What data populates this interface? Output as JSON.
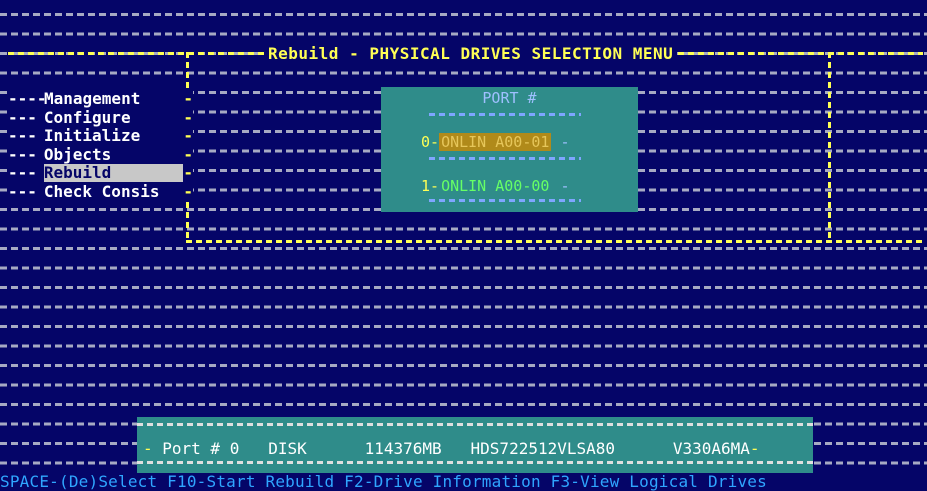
{
  "title": "Rebuild - PHYSICAL DRIVES SELECTION MENU",
  "menu": {
    "items": [
      {
        "label": "Management",
        "lead": "----"
      },
      {
        "label": "Configure",
        "lead": "---"
      },
      {
        "label": "Initialize",
        "lead": "---"
      },
      {
        "label": "Objects",
        "lead": "---"
      },
      {
        "label": "Rebuild",
        "lead": "---"
      },
      {
        "label": "Check Consis",
        "lead": "---"
      }
    ],
    "selected": "Rebuild"
  },
  "port_panel": {
    "header": "PORT #",
    "rows": [
      {
        "index": "0",
        "status": "ONLIN A00-01"
      },
      {
        "index": "1",
        "status": "ONLIN A00-00"
      }
    ]
  },
  "info_bar": {
    "port": "Port # 0",
    "type": "DISK",
    "size": "114376MB",
    "model": "HDS722512VLSA80",
    "firmware": "V330A6MA"
  },
  "status_bar": "SPACE-(De)Select F10-Start Rebuild F2-Drive Information F3-View Logical Drives",
  "colors": {
    "background": "#050568",
    "title": "#ffff55",
    "panel": "#2f8c8a",
    "status_text": "#2fa6ff",
    "online_green": "#66ff66",
    "selected_amber": "#b08a1a"
  }
}
